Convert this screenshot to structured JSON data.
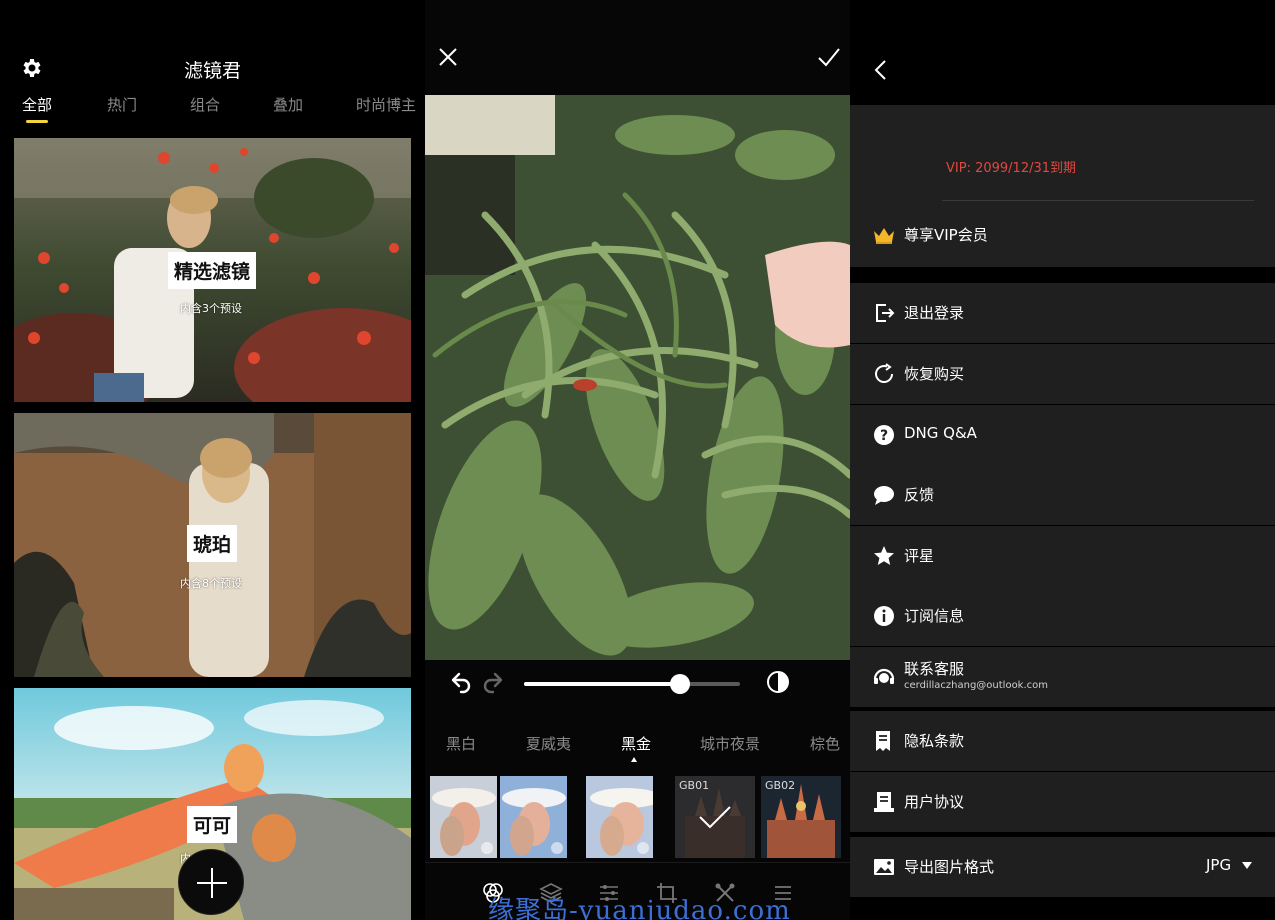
{
  "library": {
    "title": "滤镜君",
    "tabs": [
      "全部",
      "热门",
      "组合",
      "叠加",
      "时尚博主"
    ],
    "cards": [
      {
        "label": "精选滤镜",
        "sub": "内含3个预设"
      },
      {
        "label": "琥珀",
        "sub": "内含8个预设"
      },
      {
        "label": "可可",
        "sub": "内"
      }
    ]
  },
  "editor": {
    "intensity": 0.72,
    "categories": [
      "黑白",
      "夏威夷",
      "黑金",
      "城市夜景",
      "棕色"
    ],
    "active_category": "黑金",
    "thumbnails": [
      {
        "tag": ""
      },
      {
        "tag": ""
      },
      {
        "tag": ""
      },
      {
        "tag": "GB01"
      },
      {
        "tag": "GB02"
      }
    ],
    "watermark": "缘聚岛-yuanjudao.com"
  },
  "settings": {
    "vip_expiry": "VIP: 2099/12/31到期",
    "vip_member": "尊享VIP会员",
    "logout": "退出登录",
    "restore": "恢复购买",
    "dng_qa": "DNG Q&A",
    "feedback": "反馈",
    "rate": "评星",
    "subscription": "订阅信息",
    "support": "联系客服",
    "support_email": "cerdillaczhang@outlook.com",
    "privacy": "隐私条款",
    "agreement": "用户协议",
    "export_format_label": "导出图片格式",
    "export_format_value": "JPG"
  },
  "colors": {
    "accent_tab": "#f5d33b",
    "vip_red": "#e2483f",
    "row_bg": "#1f1f1f",
    "watermark": "#3c6fd6"
  }
}
